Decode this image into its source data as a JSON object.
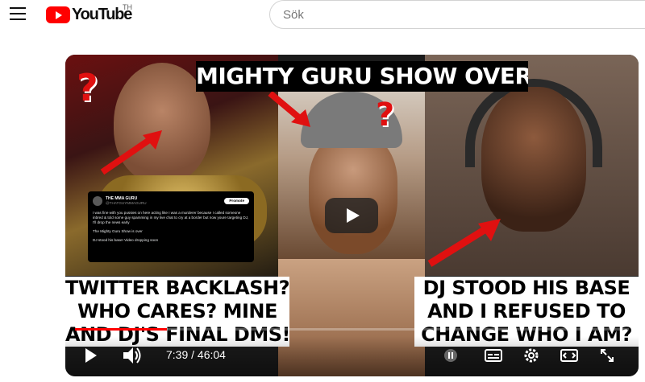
{
  "masthead": {
    "logo_text": "YouTube",
    "country_code": "TH",
    "search_placeholder": "Sök"
  },
  "video": {
    "thumbnail_title": "MIGHTY GURU SHOW OVER!",
    "caption_left": [
      "TWITTER BACKLASH?",
      "WHO CARES? MINE",
      "AND DJ'S FINAL DMS!"
    ],
    "caption_right": [
      "DJ STOOD HIS BASE",
      "AND I REFUSED TO",
      "CHANGE WHO I AM?"
    ],
    "tweet": {
      "name": "THE MMA GURU",
      "handle": "@THATGUYMMAGURU",
      "promote": "Promote",
      "body": "I was fine with you pussies on here acting like I was a murderer because I called someone inbred & told some guy spamming in my live chat to cry at a border but now youre targeting DJ, I'll drop the news early",
      "line2": "The Mighty Guru Show is over",
      "line3": "DJ stood his base! Video dropping soon"
    }
  },
  "controls": {
    "current_time": "7:39",
    "separator": "/",
    "duration": "46:04",
    "progress_fraction": 0.166
  },
  "icons": {
    "menu": "menu-icon",
    "play": "play-icon",
    "volume": "volume-icon",
    "pause": "pause-icon",
    "subtitles": "subtitles-icon",
    "settings": "gear-icon",
    "miniplayer": "miniplayer-icon",
    "fullscreen": "fullscreen-icon"
  },
  "colors": {
    "brand_red": "#ff0000",
    "caption_text": "#000000"
  }
}
